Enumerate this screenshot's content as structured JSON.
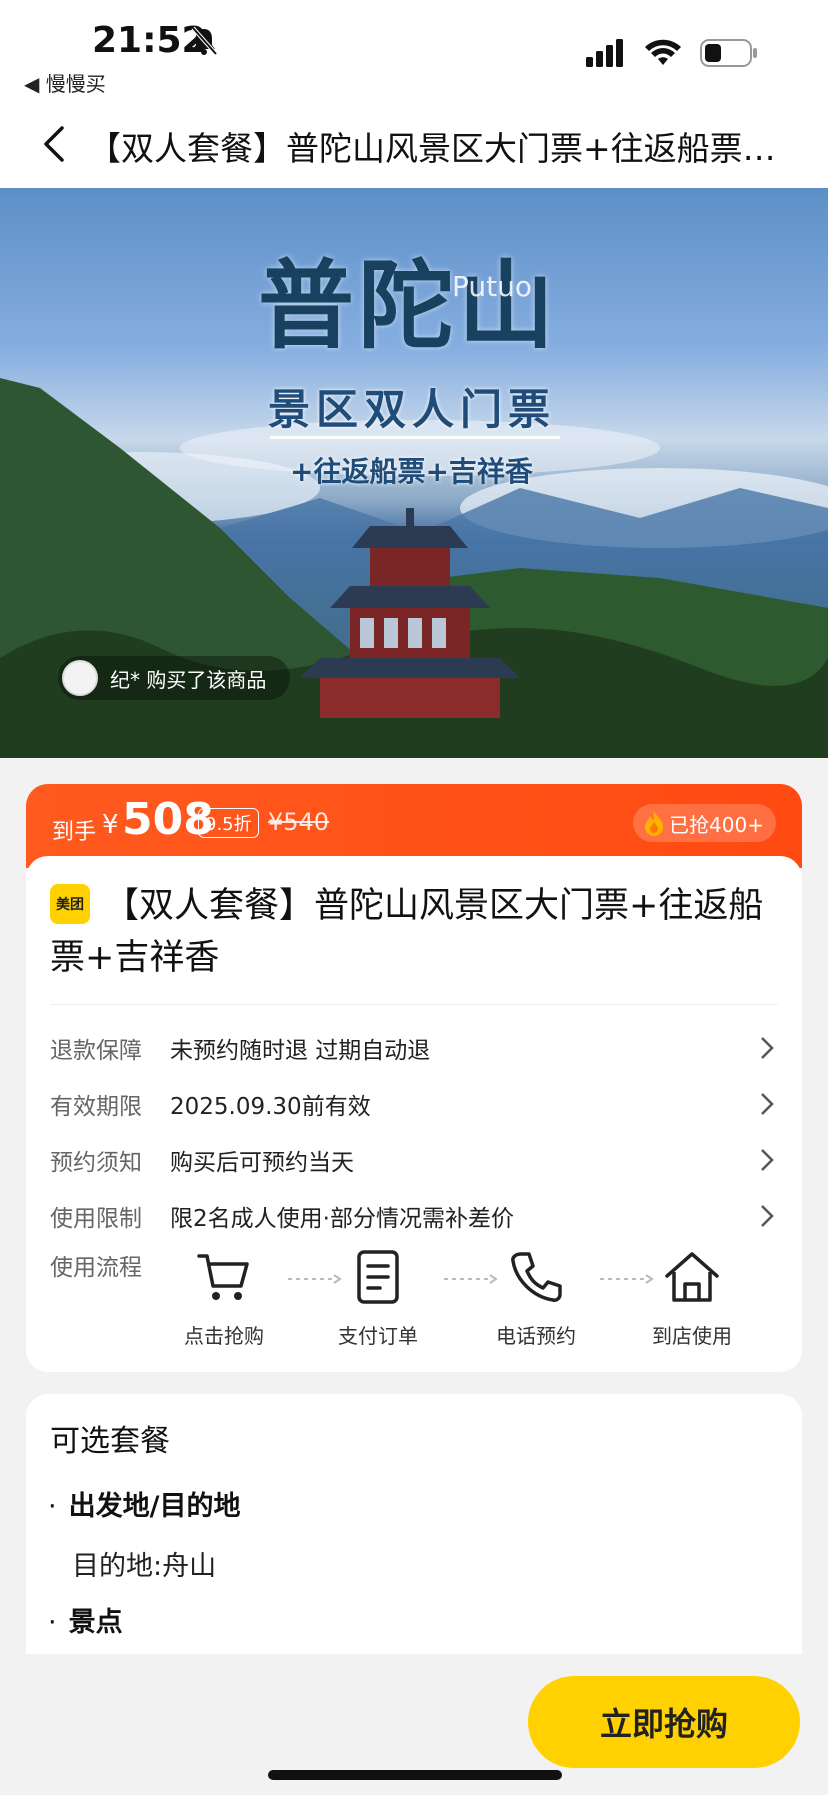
{
  "status_bar": {
    "time": "21:52",
    "back_app": "◀ 慢慢买",
    "icons": [
      "bell-slash-icon",
      "signal-icon",
      "wifi-icon",
      "battery-icon"
    ]
  },
  "nav": {
    "title": "【双人套餐】普陀山风景区大门票+往返船票+..."
  },
  "hero": {
    "title": "普陀山",
    "latin": "Putuo",
    "subtitle": "景区双人门票",
    "subtitle2": "+往返船票+吉祥香",
    "buyer_notice": "纪* 购买了该商品"
  },
  "price_bar": {
    "prefix": "到手",
    "currency": "¥",
    "price": "508",
    "discount": "9.5折",
    "original_price": "¥540",
    "sold": "已抢400+",
    "colors": {
      "bar": "#ff5a1f"
    }
  },
  "product": {
    "brand": "美团",
    "title": "【双人套餐】普陀山风景区大门票+往返船票+吉祥香"
  },
  "info_rows": [
    {
      "label": "退款保障",
      "value": "未预约随时退 过期自动退"
    },
    {
      "label": "有效期限",
      "value": "2025.09.30前有效"
    },
    {
      "label": "预约须知",
      "value": "购买后可预约当天"
    },
    {
      "label": "使用限制",
      "value": "限2名成人使用·部分情况需补差价"
    }
  ],
  "flow": {
    "label": "使用流程",
    "steps": [
      {
        "label": "点击抢购",
        "icon": "cart-icon"
      },
      {
        "label": "支付订单",
        "icon": "document-icon"
      },
      {
        "label": "电话预约",
        "icon": "phone-icon"
      },
      {
        "label": "到店使用",
        "icon": "home-icon"
      }
    ]
  },
  "package": {
    "title": "可选套餐",
    "sections": [
      {
        "heading": "出发地/目的地",
        "value": "目的地:舟山"
      },
      {
        "heading": "景点"
      }
    ]
  },
  "buy_button": {
    "label": "立即抢购",
    "color": "#ffd100"
  }
}
